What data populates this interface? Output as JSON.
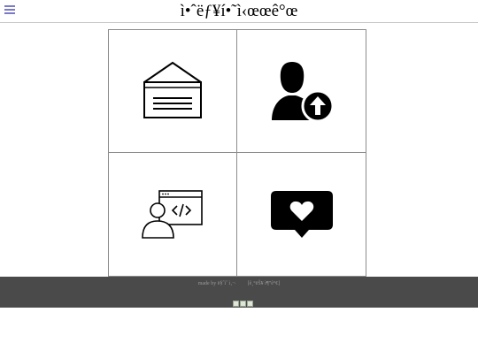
{
  "header": {
    "title": "ì•ˆëƒ¥í•˜ì‹œœê°œ"
  },
  "tiles": [
    {
      "icon": "mailbox-icon"
    },
    {
      "icon": "user-upload-icon"
    },
    {
      "icon": "developer-code-icon"
    },
    {
      "icon": "heart-message-icon"
    }
  ],
  "footer": {
    "made_by": "made by ë§ˆìˆ ì‚¬",
    "contact": "[ê¸°ëŠ¥ ì¶”ê°€]",
    "badges": [
      "badge-1",
      "badge-2",
      "badge-3"
    ]
  }
}
